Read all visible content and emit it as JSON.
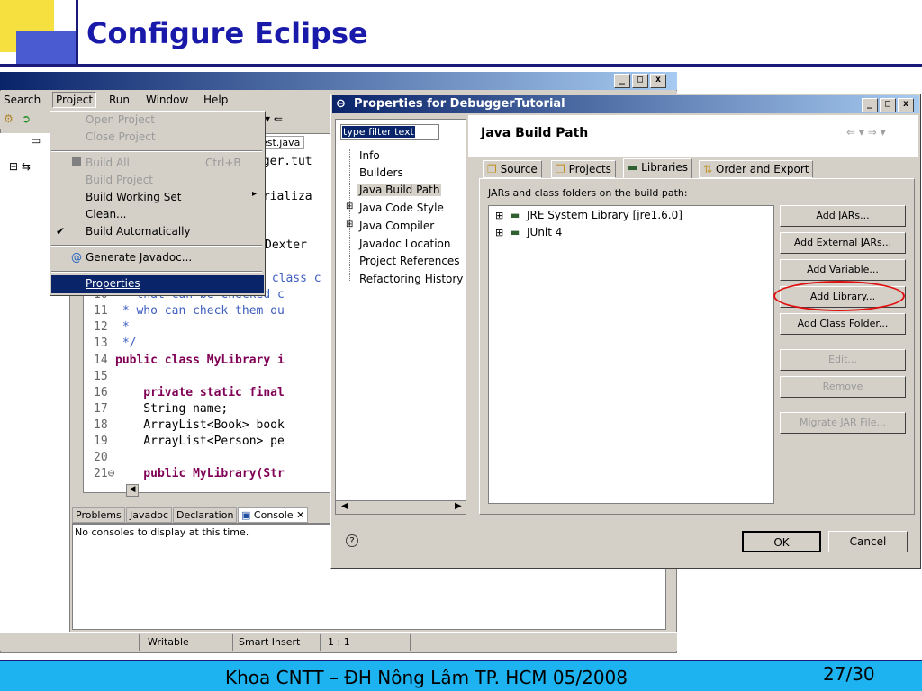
{
  "slide": {
    "title": "Configure Eclipse",
    "footer": "Khoa CNTT – ĐH Nông Lâm TP. HCM 05/2008",
    "page": "27/30"
  },
  "eclipse": {
    "menubar": [
      "Search",
      "Project",
      "Run",
      "Window",
      "Help"
    ],
    "project_menu": [
      {
        "label": "Open Project",
        "enabled": false
      },
      {
        "label": "Close Project",
        "enabled": false
      },
      {
        "label": "Build All",
        "shortcut": "Ctrl+B",
        "enabled": false
      },
      {
        "label": "Build Project",
        "enabled": false
      },
      {
        "label": "Build Working Set",
        "enabled": true,
        "submenu": true
      },
      {
        "label": "Clean...",
        "enabled": true
      },
      {
        "label": "Build Automatically",
        "enabled": true,
        "checked": true
      },
      {
        "label": "Generate Javadoc...",
        "enabled": true
      },
      {
        "label": "Properties",
        "enabled": true,
        "selected": true
      }
    ],
    "editor_tab": "est.java",
    "code_fragments": {
      "l1": "gger.tut",
      "l2": "erializa",
      "l3": "Dexter",
      "l4": " class c",
      "l10": " * that can be checked c",
      "l11": " * who can check them ou",
      "l12": " *",
      "l13": " */",
      "l14": "public class MyLibrary i",
      "l15": "",
      "l16": "    private static final",
      "l17": "    String name;",
      "l18": "    ArrayList<Book> book",
      "l19": "    ArrayList<Person> pe",
      "l20": "",
      "l21": "    public MyLibrary(Str"
    },
    "console_tabs": [
      "Problems",
      "Javadoc",
      "Declaration",
      "Console"
    ],
    "console_message": "No consoles to display at this time.",
    "status": [
      "Writable",
      "Smart Insert",
      "1 : 1"
    ]
  },
  "dialog": {
    "title": "Properties for DebuggerTutorial",
    "filter_placeholder": "type filter text",
    "tree": [
      "Info",
      "Builders",
      "Java Build Path",
      "Java Code Style",
      "Java Compiler",
      "Javadoc Location",
      "Project References",
      "Refactoring History"
    ],
    "tree_selected": "Java Build Path",
    "page_title": "Java Build Path",
    "tabs": [
      "Source",
      "Projects",
      "Libraries",
      "Order and Export"
    ],
    "active_tab": "Libraries",
    "list_label": "JARs and class folders on the build path:",
    "jars": [
      "JRE System Library [jre1.6.0]",
      "JUnit 4"
    ],
    "buttons": [
      {
        "label": "Add JARs...",
        "enabled": true
      },
      {
        "label": "Add External JARs...",
        "enabled": true
      },
      {
        "label": "Add Variable...",
        "enabled": true
      },
      {
        "label": "Add Library...",
        "enabled": true,
        "highlighted": true
      },
      {
        "label": "Add Class Folder...",
        "enabled": true
      },
      {
        "label": "Edit...",
        "enabled": false
      },
      {
        "label": "Remove",
        "enabled": false
      },
      {
        "label": "Migrate JAR File...",
        "enabled": false
      }
    ],
    "ok": "OK",
    "cancel": "Cancel",
    "help_icon": "?"
  }
}
